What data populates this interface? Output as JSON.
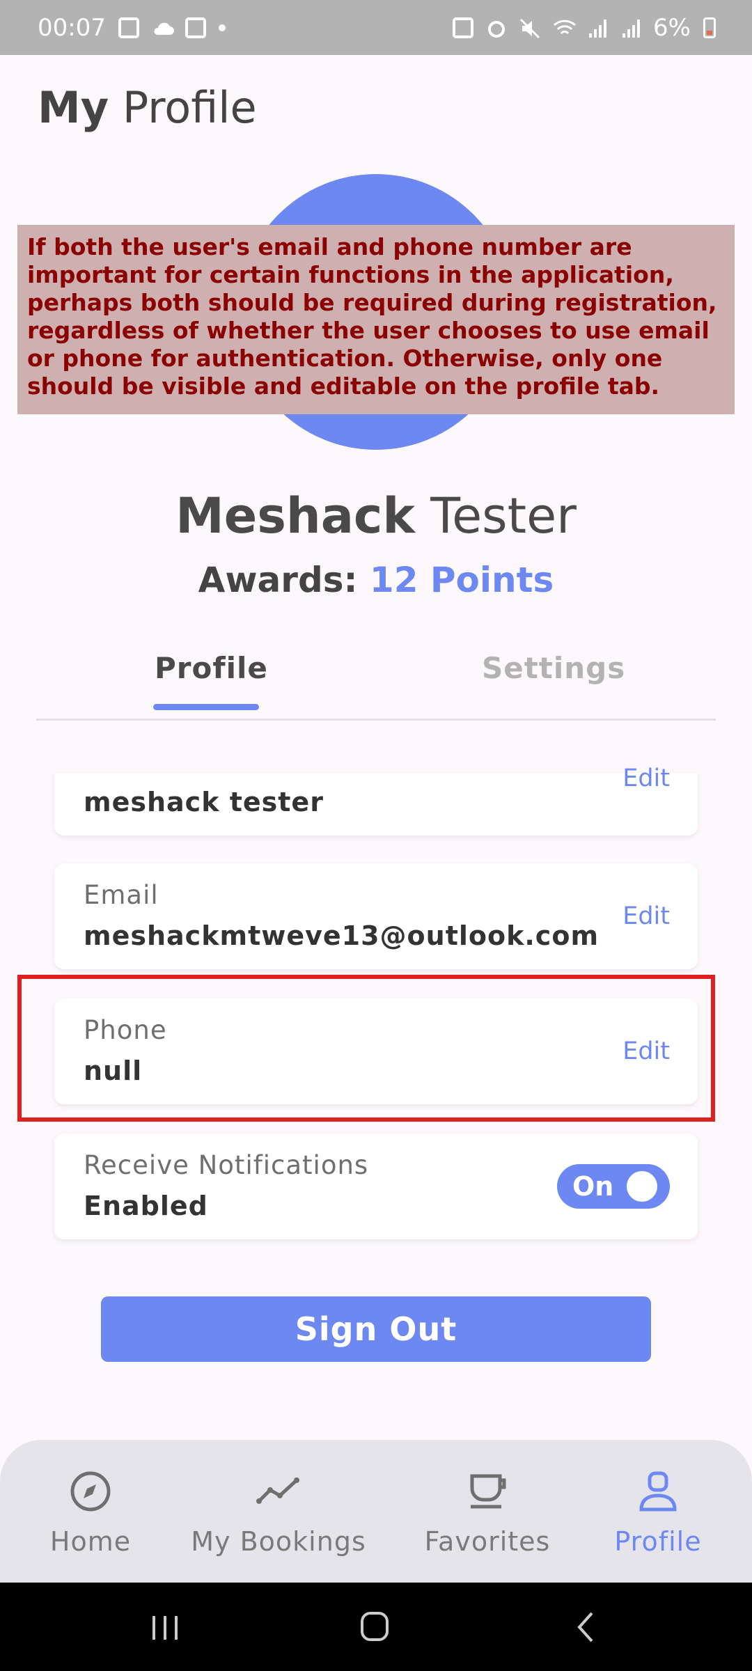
{
  "status_bar": {
    "time": "00:07",
    "battery": "6%"
  },
  "header": {
    "title_bold": "My",
    "title_rest": " Profile"
  },
  "annotation": {
    "text": "If both the user's email and phone number are important for certain functions in the application, perhaps both should be required during registration, regardless of whether the user chooses to use email or phone for authentication. Otherwise, only one should be visible and editable on the profile tab."
  },
  "user": {
    "first_name": "Meshack",
    "last_name": " Tester",
    "awards_label": "Awards: ",
    "awards_value": "12 Points"
  },
  "tabs": [
    {
      "label": "Profile",
      "active": true
    },
    {
      "label": "Settings",
      "active": false
    }
  ],
  "fields": {
    "name": {
      "value": "meshack tester",
      "edit": "Edit"
    },
    "email": {
      "label": "Email",
      "value": "meshackmtweve13@outlook.com",
      "edit": "Edit"
    },
    "phone": {
      "label": "Phone",
      "value": "null",
      "edit": "Edit"
    },
    "notifications": {
      "label": "Receive Notifications",
      "value": "Enabled",
      "toggle": "On"
    }
  },
  "sign_out_label": "Sign Out",
  "bottom_nav": [
    {
      "label": "Home",
      "icon": "compass-icon"
    },
    {
      "label": "My Bookings",
      "icon": "trend-line-icon"
    },
    {
      "label": "Favorites",
      "icon": "cup-icon"
    },
    {
      "label": "Profile",
      "icon": "user-icon",
      "active": true
    }
  ],
  "colors": {
    "accent": "#6e88f2",
    "highlight": "#e02020",
    "annotation_bg": "#cfb0b0",
    "annotation_text": "#8b0000"
  }
}
